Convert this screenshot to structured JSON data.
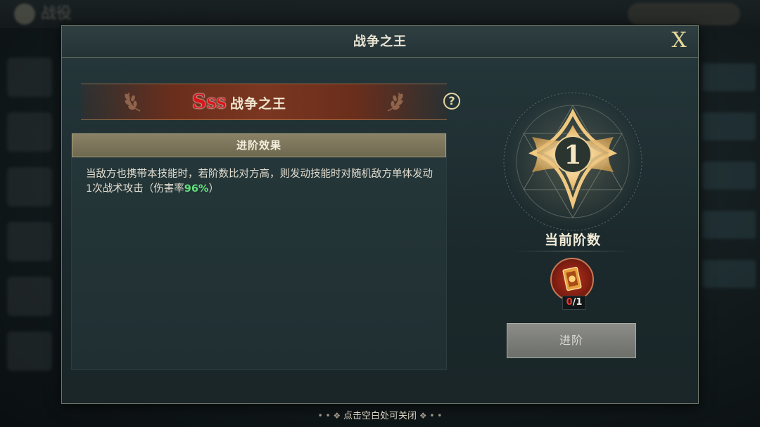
{
  "background": {
    "back_label": "战役"
  },
  "dialog": {
    "title": "战争之王",
    "close_label": "X"
  },
  "skill": {
    "grade": {
      "big": "S",
      "small": "SS"
    },
    "name": "战争之王",
    "help_icon": "question-mark-icon"
  },
  "effect": {
    "header": "进阶效果",
    "text_before": "当敌方也携带本技能时，若阶数比对方高，则发动技能时对随机敌方单体发动1次战术攻击（伤害率",
    "highlight": "96%",
    "text_after": "）",
    "highlight_color": "#5fe07a"
  },
  "rank": {
    "current": "1",
    "label": "当前阶数"
  },
  "material": {
    "icon": "scroll-icon",
    "owned": "0",
    "required": "/1"
  },
  "advance_button": {
    "label": "进阶"
  },
  "footer": {
    "hint": "点击空白处可关闭"
  },
  "colors": {
    "accent_gold": "#e6d89a",
    "banner_red": "#7a3620",
    "grade_red": "#d8171b"
  }
}
